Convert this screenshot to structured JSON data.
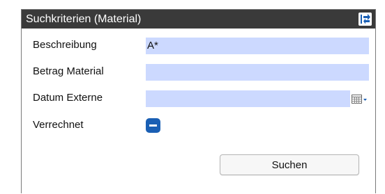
{
  "panel": {
    "title": "Suchkriterien (Material)",
    "collapse_icon": "collapse-panel-icon",
    "accent_color": "#1a5fb4",
    "titlebar_color": "#3a3a3a",
    "field_color": "#ccd9ff"
  },
  "fields": {
    "beschreibung": {
      "label": "Beschreibung",
      "value": "A*"
    },
    "betrag_material": {
      "label": "Betrag Material",
      "value": ""
    },
    "datum_externe": {
      "label": "Datum Externe",
      "value": "",
      "icon": "calendar-dropdown-icon"
    },
    "verrechnet": {
      "label": "Verrechnet",
      "state": "indeterminate"
    }
  },
  "actions": {
    "search_label": "Suchen"
  }
}
